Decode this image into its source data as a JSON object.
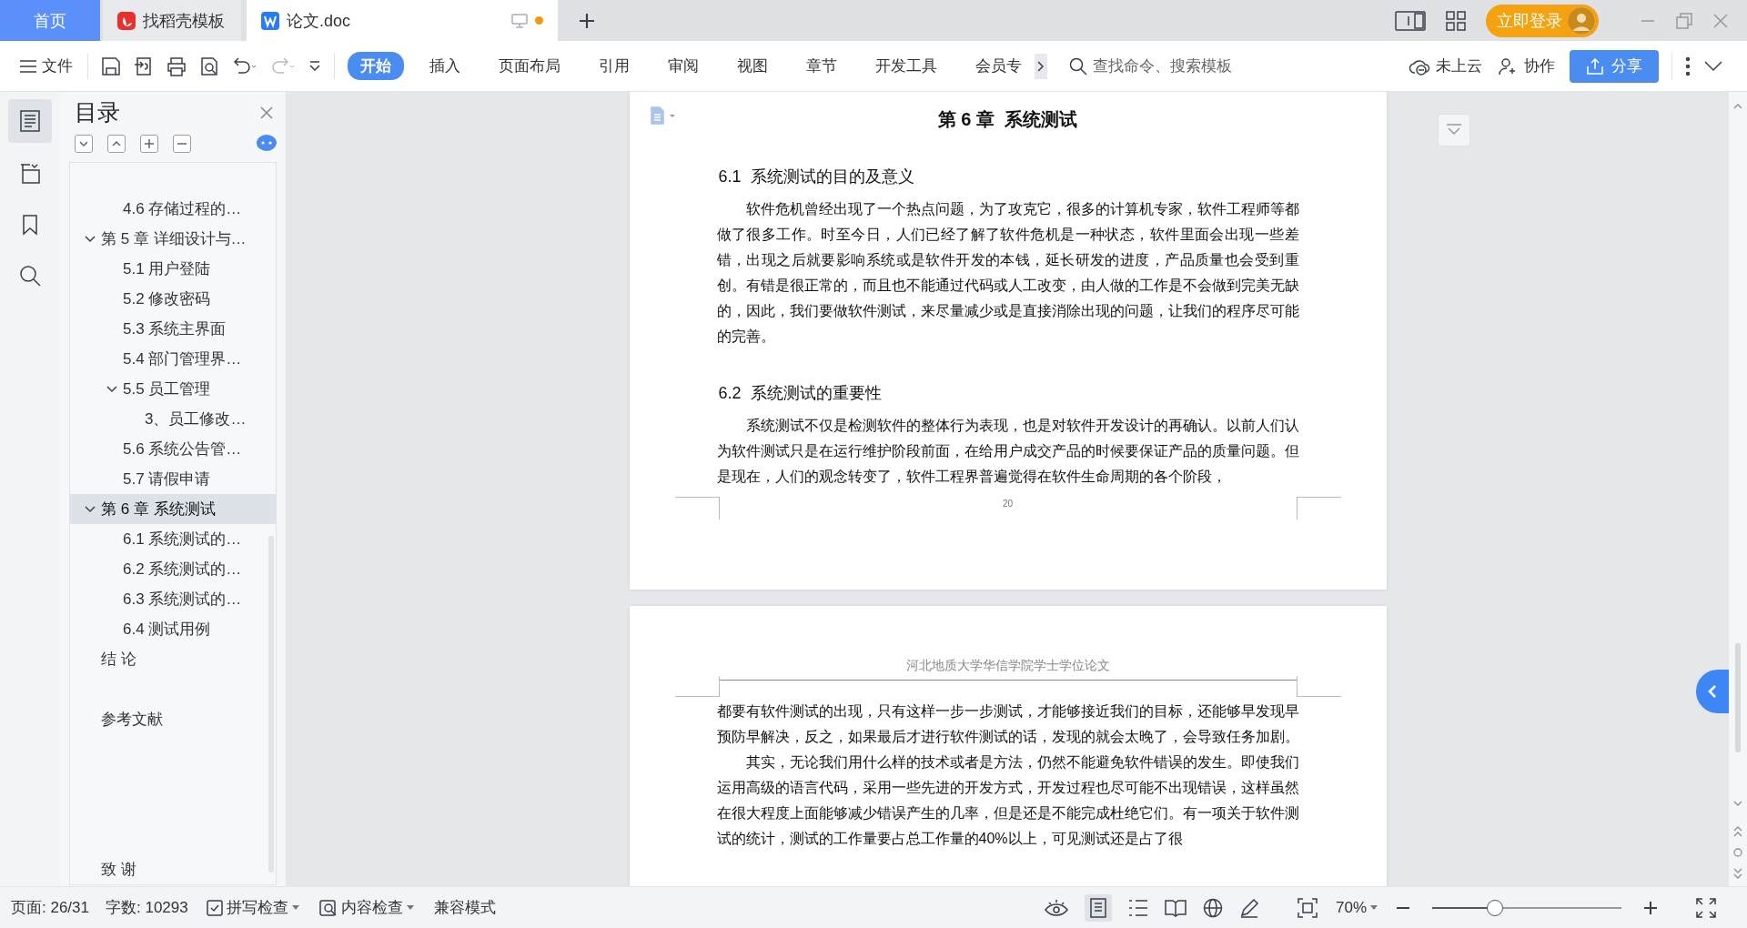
{
  "title_bar": {
    "tabs": [
      {
        "label": "首页",
        "kind": "home",
        "selected": false,
        "modified": false
      },
      {
        "label": "找稻壳模板",
        "kind": "template",
        "selected": false,
        "modified": false
      },
      {
        "label": "论文.doc",
        "kind": "document",
        "selected": true,
        "modified": true
      }
    ],
    "login_button": "立即登录"
  },
  "toolbar": {
    "file_menu": "文件",
    "tabs": [
      {
        "label": "开始",
        "selected": true
      },
      {
        "label": "插入",
        "selected": false
      },
      {
        "label": "页面布局",
        "selected": false
      },
      {
        "label": "引用",
        "selected": false
      },
      {
        "label": "审阅",
        "selected": false
      },
      {
        "label": "视图",
        "selected": false
      },
      {
        "label": "章节",
        "selected": false
      },
      {
        "label": "开发工具",
        "selected": false
      },
      {
        "label": "会员专",
        "selected": false
      }
    ],
    "search": {
      "placeholder": "查找命令、搜索模板"
    },
    "cloud_status": "未上云",
    "collaborate": "协作",
    "share": "分享"
  },
  "outline": {
    "title": "目录",
    "items": [
      {
        "kind": "hidden-parent",
        "children": [
          {
            "kind": "heading",
            "label": "4.6  存储过程的…",
            "selected": false
          }
        ]
      },
      {
        "kind": "heading",
        "label": "第 5 章  详细设计与…",
        "expanded": true,
        "selected": false,
        "children": [
          {
            "kind": "heading",
            "label": "5.1  用户登陆",
            "selected": false
          },
          {
            "kind": "heading",
            "label": "5.2  修改密码",
            "selected": false
          },
          {
            "kind": "heading",
            "label": "5.3  系统主界面",
            "selected": false
          },
          {
            "kind": "heading",
            "label": "5.4  部门管理界…",
            "selected": false
          },
          {
            "kind": "heading",
            "label": "5.5  员工管理",
            "expanded": true,
            "selected": false,
            "children": [
              {
                "kind": "heading",
                "label": "3、员工修改…",
                "selected": false
              }
            ]
          },
          {
            "kind": "heading",
            "label": "5.6  系统公告管…",
            "selected": false
          },
          {
            "kind": "heading",
            "label": "5.7 请假申请",
            "selected": false
          }
        ]
      },
      {
        "kind": "heading",
        "label": "第 6 章  系统测试",
        "expanded": true,
        "selected": true,
        "children": [
          {
            "kind": "heading",
            "label": "6.1  系统测试的…",
            "selected": false
          },
          {
            "kind": "heading",
            "label": "6.2  系统测试的…",
            "selected": false
          },
          {
            "kind": "heading",
            "label": "6.3  系统测试的…",
            "selected": false
          },
          {
            "kind": "heading",
            "label": "6.4  测试用例",
            "selected": false
          }
        ]
      },
      {
        "kind": "heading",
        "label": "结  论",
        "selected": false
      },
      {
        "kind": "empty",
        "selected": false
      },
      {
        "kind": "heading",
        "label": "参考文献",
        "selected": false
      },
      {
        "kind": "empty",
        "selected": false
      },
      {
        "kind": "empty",
        "selected": false
      },
      {
        "kind": "empty",
        "selected": false
      },
      {
        "kind": "empty",
        "selected": false
      },
      {
        "kind": "heading",
        "label": "致  谢",
        "selected": false
      }
    ]
  },
  "document": {
    "pages": [
      {
        "chapter_title": "第 6 章  系统测试",
        "sections": [
          {
            "heading": "6.1  系统测试的目的及意义",
            "paragraphs": [
              {
                "indent": true,
                "text": "软件危机曾经出现了一个热点问题，为了攻克它，很多的计算机专家，软件工程师等都做了很多工作。时至今日，人们已经了解了软件危机是一种状态，软件里面会出现一些差错，出现之后就要影响系统或是软件开发的本钱，延长研发的进度，产品质量也会受到重创。有错是很正常的，而且也不能通过代码或人工改变，由人做的工作是不会做到完美无缺的，因此，我们要做软件测试，来尽量减少或是直接消除出现的问题，让我们的程序尽可能的完善。"
              }
            ]
          },
          {
            "heading": "6.2  系统测试的重要性",
            "paragraphs": [
              {
                "indent": true,
                "text": "系统测试不仅是检测软件的整体行为表现，也是对软件开发设计的再确认。以前人们认为软件测试只是在运行维护阶段前面，在给用户成交产品的时候要保证产品的质量问题。但是现在，人们的观念转变了，软件工程界普遍觉得在软件生命周期的各个阶段，"
              }
            ]
          }
        ],
        "page_number": "20"
      },
      {
        "header": "河北地质大学华信学院学士学位论文",
        "paragraphs": [
          {
            "indent": false,
            "text": "都要有软件测试的出现，只有这样一步一步测试，才能够接近我们的目标，还能够早发现早预防早解决，反之，如果最后才进行软件测试的话，发现的就会太晚了，会导致任务加剧。"
          },
          {
            "indent": true,
            "text": "其实，无论我们用什么样的技术或者是方法，仍然不能避免软件错误的发生。即使我们运用高级的语言代码，采用一些先进的开发方式，开发过程也尽可能不出现错误，这样虽然在很大程度上面能够减少错误产生的几率，但是还是不能完成杜绝它们。有一项关于软件测试的统计，测试的工作量要占总工作量的40%以上，可见测试还是占了很"
          }
        ]
      }
    ]
  },
  "status_bar": {
    "page": "页面: 26/31",
    "word_count": "字数: 10293",
    "spell_check": "拼写检查",
    "content_check": "内容检查",
    "compat_mode": "兼容模式",
    "zoom": "70%",
    "zoom_slider": {
      "level": 0.33
    }
  }
}
